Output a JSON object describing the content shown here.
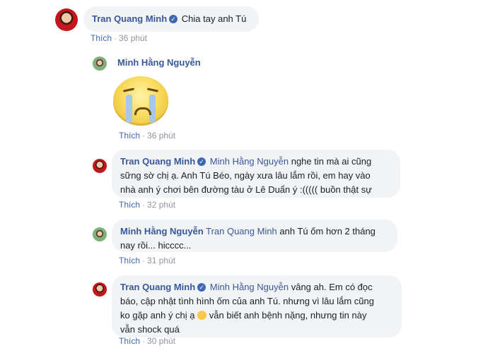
{
  "comments": [
    {
      "author": "Tran Quang Minh",
      "text": "Chia tay anh Tú",
      "like_label": "Thích",
      "time": "36 phút"
    },
    {
      "author": "Minh Hằng Nguyễn",
      "sticker": "crying-face-sticker",
      "like_label": "Thích",
      "time": "36 phút"
    },
    {
      "author": "Tran Quang Minh",
      "mention": "Minh Hằng Nguyễn",
      "text_line1": "nghe tin mà ai cũng",
      "text_line2": "sững sờ chị ạ. Anh Tú Béo, ngày xưa lâu lắm rồi, em hay vào",
      "text_line3": "nhà anh ý chơi bên đường tàu ở Lê Duẩn ý :((((( buồn thật sự",
      "like_label": "Thích",
      "time": "32 phút"
    },
    {
      "author": "Minh Hằng Nguyễn",
      "mention": "Tran Quang Minh",
      "text_line1": "anh Tú ốm hơn 2 tháng",
      "text_line2": "nay rồi... hicccc...",
      "like_label": "Thích",
      "time": "31 phút"
    },
    {
      "author": "Tran Quang Minh",
      "mention": "Minh Hằng Nguyễn",
      "text_line1": "vâng ah. Em có đọc",
      "text_line2": "báo, cập nhật tình hình ốm của anh Tú. nhưng vì lâu lắm cũng",
      "text_line3a": "ko gặp anh ý chị ạ",
      "text_line3b": "vẫn biết anh bệnh nặng, nhưng tin này",
      "text_line4": "vẫn shock quá",
      "emoji": "sad-face-emoji",
      "like_label": "Thích",
      "time": "30 phút"
    }
  ],
  "colors": {
    "link": "#385898",
    "bubble": "#f2f3f5",
    "meta": "#90949c",
    "like": "#4267b2"
  }
}
